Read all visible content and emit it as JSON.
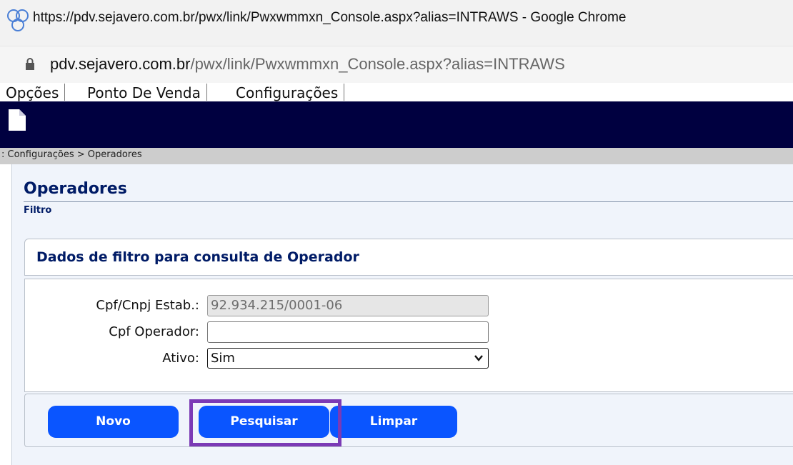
{
  "window": {
    "title": "https://pdv.sejavero.com.br/pwx/link/Pwxwmmxn_Console.aspx?alias=INTRAWS - Google Chrome",
    "address_host": "pdv.sejavero.com.br",
    "address_path": "/pwx/link/Pwxwmmxn_Console.aspx?alias=INTRAWS"
  },
  "menu": {
    "items": [
      "Opções",
      "Ponto De Venda",
      "Configurações"
    ]
  },
  "breadcrumb": ": Configurações > Operadores",
  "page": {
    "title": "Operadores",
    "subtitle": "Filtro"
  },
  "filter": {
    "heading": "Dados de filtro para consulta de Operador",
    "fields": {
      "cnpj_label": "Cpf/Cnpj Estab.:",
      "cnpj_value": "92.934.215/0001-06",
      "cpf_label": "Cpf Operador:",
      "cpf_value": "",
      "ativo_label": "Ativo:",
      "ativo_value": "Sim"
    }
  },
  "buttons": {
    "novo": "Novo",
    "pesquisar": "Pesquisar",
    "limpar": "Limpar"
  },
  "colors": {
    "banner": "#000040",
    "button": "#0a55ff",
    "heading": "#001b66",
    "highlight": "#7b3ab5"
  },
  "icons": {
    "browser": "chrome-profile-icon",
    "lock": "lock-icon",
    "banner": "document-icon",
    "select": "chevron-down-icon"
  }
}
